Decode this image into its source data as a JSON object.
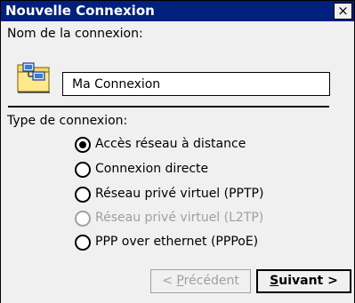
{
  "window": {
    "title": "Nouvelle Connexion",
    "close_glyph": "×"
  },
  "connection_name": {
    "label": "Nom de la connexion:",
    "value": "Ma Connexion",
    "icon": "network-connection-icon"
  },
  "connection_type": {
    "label": "Type de connexion:",
    "options": [
      {
        "label": "Accès réseau à distance",
        "checked": true,
        "enabled": true
      },
      {
        "label": "Connexion directe",
        "checked": false,
        "enabled": true
      },
      {
        "label": "Réseau privé virtuel (PPTP)",
        "checked": false,
        "enabled": true
      },
      {
        "label": "Réseau privé virtuel (L2TP)",
        "checked": false,
        "enabled": false
      },
      {
        "label": "PPP over ethernet (PPPoE)",
        "checked": false,
        "enabled": true
      }
    ]
  },
  "buttons": {
    "prev_prefix": "< ",
    "prev_mnemonic": "P",
    "prev_rest": "récédent",
    "prev_enabled": false,
    "next_mnemonic": "S",
    "next_rest": "uivant >",
    "next_enabled": true
  },
  "colors": {
    "titlebar": "#00207d",
    "window_bg": "#f0f0f0",
    "disabled_text": "#a0a0a0"
  }
}
